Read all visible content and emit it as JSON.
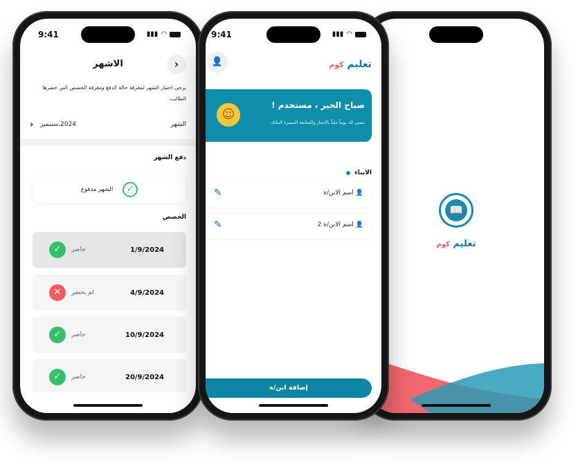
{
  "status_bar": {
    "time": "9:41"
  },
  "screen_month": {
    "title": "الاشهر",
    "back_icon": "chevron-right-icon",
    "description": "يرجى اختيار الشهر لمعرفة حالة الدفع ومعرفة الحصص التي حضرها الطالب.",
    "month_label": "الشهر",
    "month_value": "2024،سبتمبر",
    "payment_section_title": "دفع الشهر",
    "payment_status": "الشهر مدفوع",
    "lessons_section_title": "الحصص",
    "lessons": [
      {
        "date": "1/9/2024",
        "status": "حاضر",
        "attended": true
      },
      {
        "date": "4/9/2024",
        "status": "لم يحضر",
        "attended": false
      },
      {
        "date": "10/9/2024",
        "status": "حاضر",
        "attended": true
      },
      {
        "date": "20/9/2024",
        "status": "حاضر",
        "attended": true
      }
    ],
    "colors": {
      "present": "#34c06a",
      "absent": "#f25c5c"
    }
  },
  "screen_home": {
    "brand_main": "تعليم",
    "brand_sub": "كوم",
    "welcome_title": "صباح الخير ، مستخدم !",
    "welcome_subtitle": "نتمنى لك يوماً ملياً بالإنجاز والمتابعة المميزة لأبنائك",
    "kids_title": "الابناء",
    "kids": [
      {
        "name": "اسم الابن/ة"
      },
      {
        "name": "اسم الابن/ة 2"
      }
    ],
    "add_button": "إضافة ابن/ة",
    "colors": {
      "primary": "#0f8eab",
      "brand_red": "#f0565f",
      "brand_blue": "#1577a6"
    }
  },
  "screen_splash": {
    "brand_main": "تعليم",
    "brand_sub": "كوم",
    "logo_icon": "open-book-icon"
  }
}
